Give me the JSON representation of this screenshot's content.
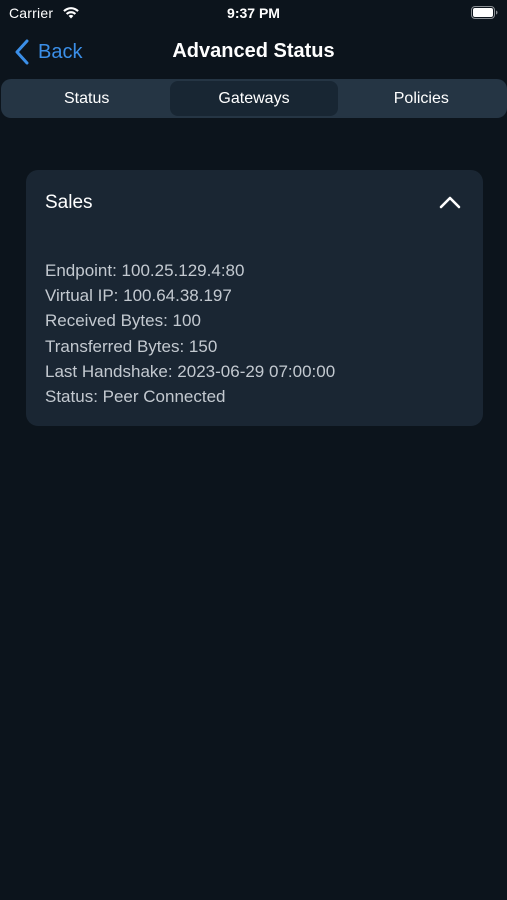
{
  "status_bar": {
    "carrier": "Carrier",
    "time": "9:37 PM",
    "wifi_icon": "wifi-icon",
    "battery_icon": "battery-icon"
  },
  "nav": {
    "back_label": "Back",
    "back_icon": "chevron-left-icon",
    "title": "Advanced Status",
    "accent_color": "#3b8fe8"
  },
  "tabs": [
    {
      "label": "Status",
      "selected": false
    },
    {
      "label": "Gateways",
      "selected": true
    },
    {
      "label": "Policies",
      "selected": false
    }
  ],
  "gateway": {
    "name": "Sales",
    "expanded": true,
    "toggle_icon": "chevron-up-icon",
    "details": [
      "Endpoint: 100.25.129.4:80",
      "Virtual IP: 100.64.38.197",
      "Received Bytes: 100",
      "Transferred Bytes: 150",
      "Last Handshake: 2023-06-29 07:00:00",
      "Status: Peer Connected"
    ]
  },
  "colors": {
    "background": "#0c141c",
    "card": "#1a2633",
    "segmented_track": "#253544",
    "segment_selected": "#182633"
  }
}
